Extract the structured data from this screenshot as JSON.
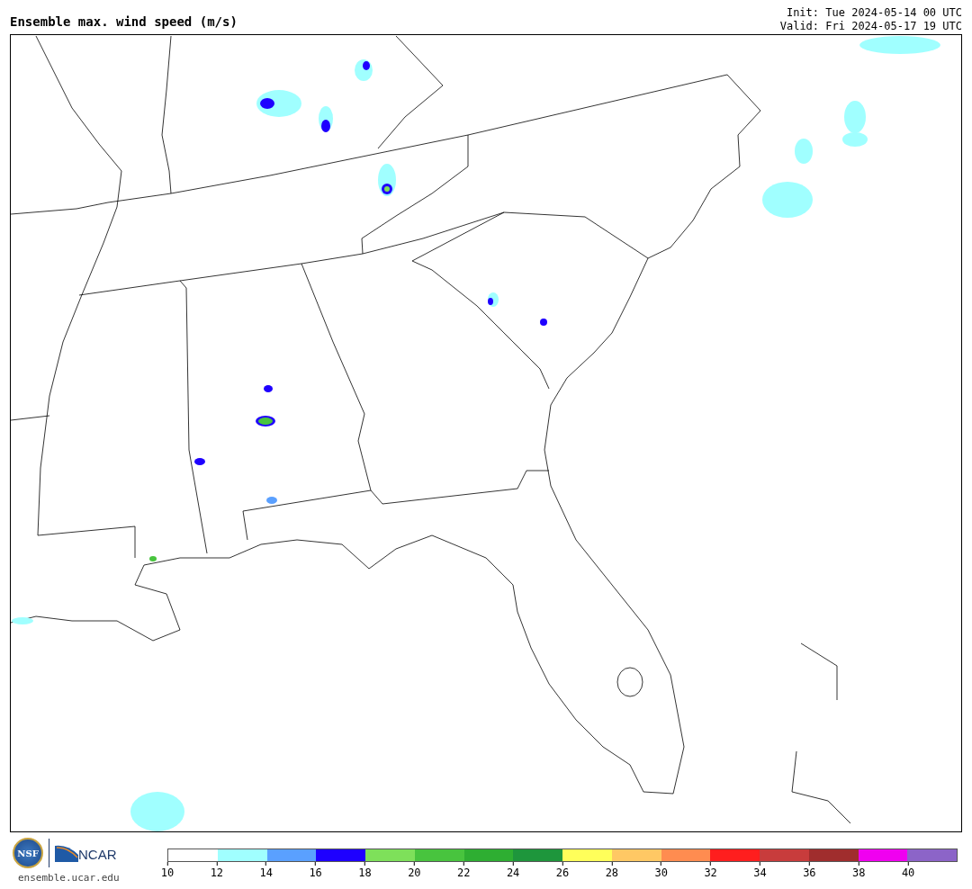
{
  "header": {
    "title": "Ensemble max. wind speed (m/s)",
    "init": "Init: Tue 2024-05-14 00 UTC",
    "valid": "Valid: Fri 2024-05-17 19 UTC"
  },
  "footer": {
    "nsf": "NSF",
    "ncar": "NCAR",
    "url": "ensemble.ucar.edu"
  },
  "colorbar": {
    "segments": [
      {
        "color": "#ffffff"
      },
      {
        "color": "#a0ffff"
      },
      {
        "color": "#5aa0ff"
      },
      {
        "color": "#1e00ff"
      },
      {
        "color": "#7ee05a"
      },
      {
        "color": "#48c43e"
      },
      {
        "color": "#2eae32"
      },
      {
        "color": "#1e963c"
      },
      {
        "color": "#ffff5a"
      },
      {
        "color": "#ffc864"
      },
      {
        "color": "#ff8c50"
      },
      {
        "color": "#ff1e1e"
      },
      {
        "color": "#c83c3c"
      },
      {
        "color": "#a02d2d"
      },
      {
        "color": "#f000f0"
      },
      {
        "color": "#8c64c8"
      }
    ],
    "ticks": [
      "10",
      "12",
      "14",
      "16",
      "18",
      "20",
      "22",
      "24",
      "26",
      "28",
      "30",
      "32",
      "34",
      "36",
      "38",
      "40"
    ]
  }
}
